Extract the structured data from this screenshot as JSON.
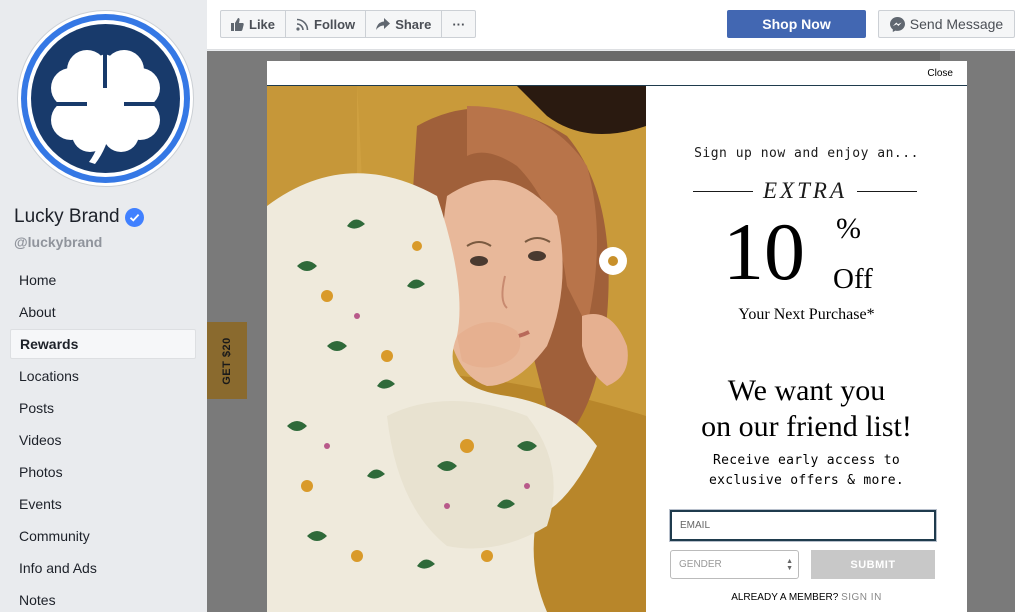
{
  "page": {
    "name": "Lucky Brand",
    "handle": "@luckybrand"
  },
  "sidebar": {
    "items": [
      {
        "label": "Home",
        "active": false
      },
      {
        "label": "About",
        "active": false
      },
      {
        "label": "Rewards",
        "active": true
      },
      {
        "label": "Locations",
        "active": false
      },
      {
        "label": "Posts",
        "active": false
      },
      {
        "label": "Videos",
        "active": false
      },
      {
        "label": "Photos",
        "active": false
      },
      {
        "label": "Events",
        "active": false
      },
      {
        "label": "Community",
        "active": false
      },
      {
        "label": "Info and Ads",
        "active": false
      },
      {
        "label": "Notes",
        "active": false
      }
    ]
  },
  "actions": {
    "like": "Like",
    "follow": "Follow",
    "share": "Share",
    "more": "···",
    "shop_now": "Shop Now",
    "send_message": "Send Message"
  },
  "tab": {
    "label": "GET $20"
  },
  "modal": {
    "close": "Close",
    "tagline": "Sign up now and enjoy an...",
    "extra": "EXTRA",
    "amount": "10",
    "percent": "%",
    "off": "Off",
    "next_purchase": "Your Next Purchase*",
    "headline_1": "We want you",
    "headline_2": "on our friend list!",
    "sub_1": "Receive early access to",
    "sub_2": "exclusive offers & more.",
    "email_placeholder": "EMAIL",
    "gender_placeholder": "GENDER",
    "submit": "SUBMIT",
    "member_prompt": "ALREADY A MEMBER?",
    "sign_in": "SIGN IN"
  },
  "colors": {
    "brand_navy": "#183a6b",
    "ring_blue": "#3578e5",
    "facebook_blue": "#4267b2",
    "mustard": "#c99a3a"
  }
}
